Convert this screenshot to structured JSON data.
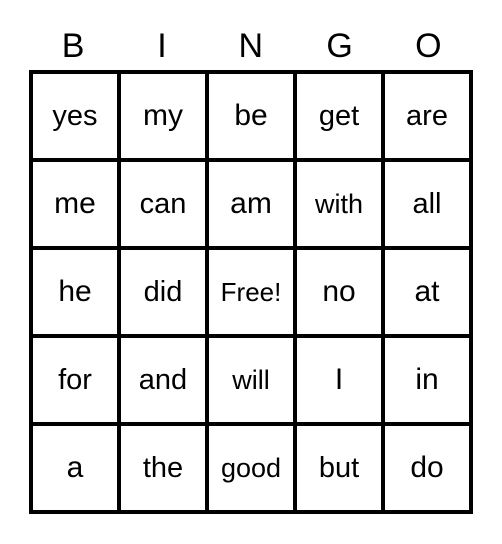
{
  "card": {
    "type": "bingo-card",
    "headers": [
      "B",
      "I",
      "N",
      "G",
      "O"
    ],
    "grid_size": "5x5",
    "colors": {
      "background": "#ffffff",
      "border": "#000000",
      "text": "#000000"
    },
    "rows": [
      {
        "cells": [
          "yes",
          "my",
          "be",
          "get",
          "are"
        ]
      },
      {
        "cells": [
          "me",
          "can",
          "am",
          "with",
          "all"
        ]
      },
      {
        "cells": [
          "he",
          "did",
          "Free!",
          "no",
          "at"
        ]
      },
      {
        "cells": [
          "for",
          "and",
          "will",
          "I",
          "in"
        ]
      },
      {
        "cells": [
          "a",
          "the",
          "good",
          "but",
          "do"
        ]
      }
    ],
    "free_space": {
      "row": 3,
      "column": 3,
      "label": "Free!"
    }
  }
}
